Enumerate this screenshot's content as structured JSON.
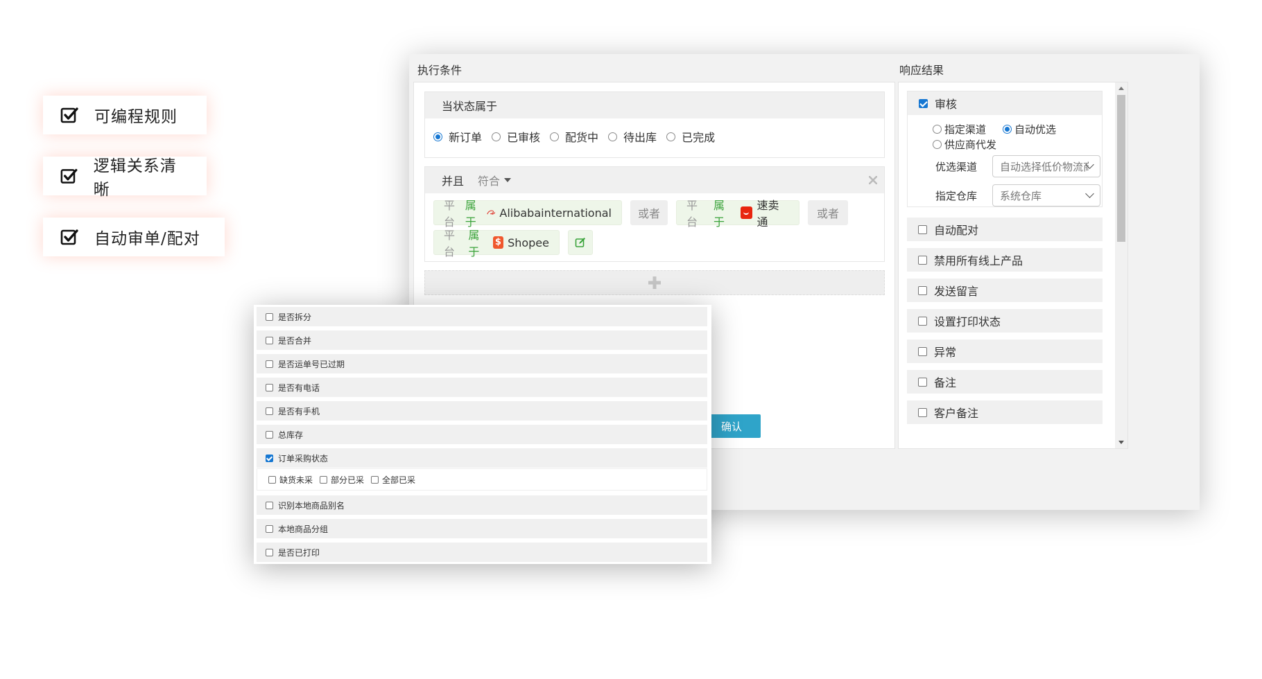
{
  "features": [
    {
      "label": "可编程规则"
    },
    {
      "label": "逻辑关系清晰"
    },
    {
      "label": "自动审单/配对"
    }
  ],
  "conditions": {
    "title": "执行条件",
    "status_block": {
      "label": "当状态属于",
      "options": [
        "新订单",
        "已审核",
        "配货中",
        "待出库",
        "已完成"
      ],
      "selected": "新订单"
    },
    "and_block": {
      "and_label": "并且",
      "match_label": "符合",
      "key_label": "平台",
      "relation_label": "属于",
      "or_label": "或者",
      "platforms": [
        "Alibabainternational",
        "速卖通",
        "Shopee"
      ]
    }
  },
  "results": {
    "title": "响应结果",
    "audit": {
      "label": "审核",
      "checked": true,
      "channel_options": [
        "指定渠道",
        "自动优选",
        "供应商代发"
      ],
      "selected_channel": "自动优选",
      "preferred_channel_label": "优选渠道",
      "preferred_channel_value": "自动选择低价物流商",
      "warehouse_label": "指定仓库",
      "warehouse_value": "系统仓库"
    },
    "items": [
      "自动配对",
      "禁用所有线上产品",
      "发送留言",
      "设置打印状态",
      "异常",
      "备注",
      "客户备注"
    ]
  },
  "confirm_label": "确认",
  "checklist": {
    "items": [
      {
        "label": "是否拆分",
        "checked": false
      },
      {
        "label": "是否合并",
        "checked": false
      },
      {
        "label": "是否运单号已过期",
        "checked": false
      },
      {
        "label": "是否有电话",
        "checked": false
      },
      {
        "label": "是否有手机",
        "checked": false
      },
      {
        "label": "总库存",
        "checked": false
      },
      {
        "label": "订单采购状态",
        "checked": true
      },
      {
        "label": "识别本地商品别名",
        "checked": false
      },
      {
        "label": "本地商品分组",
        "checked": false
      },
      {
        "label": "是否已打印",
        "checked": false
      }
    ],
    "purchase_sub_options": [
      "缺货未采",
      "部分已采",
      "全部已采"
    ]
  },
  "colors": {
    "accent": "#1677d2",
    "confirm_button": "#2fa4c9",
    "relation_green": "#3aa33a",
    "tag_bg": "#eef6e9",
    "feature_glow": "#ff6e50"
  }
}
